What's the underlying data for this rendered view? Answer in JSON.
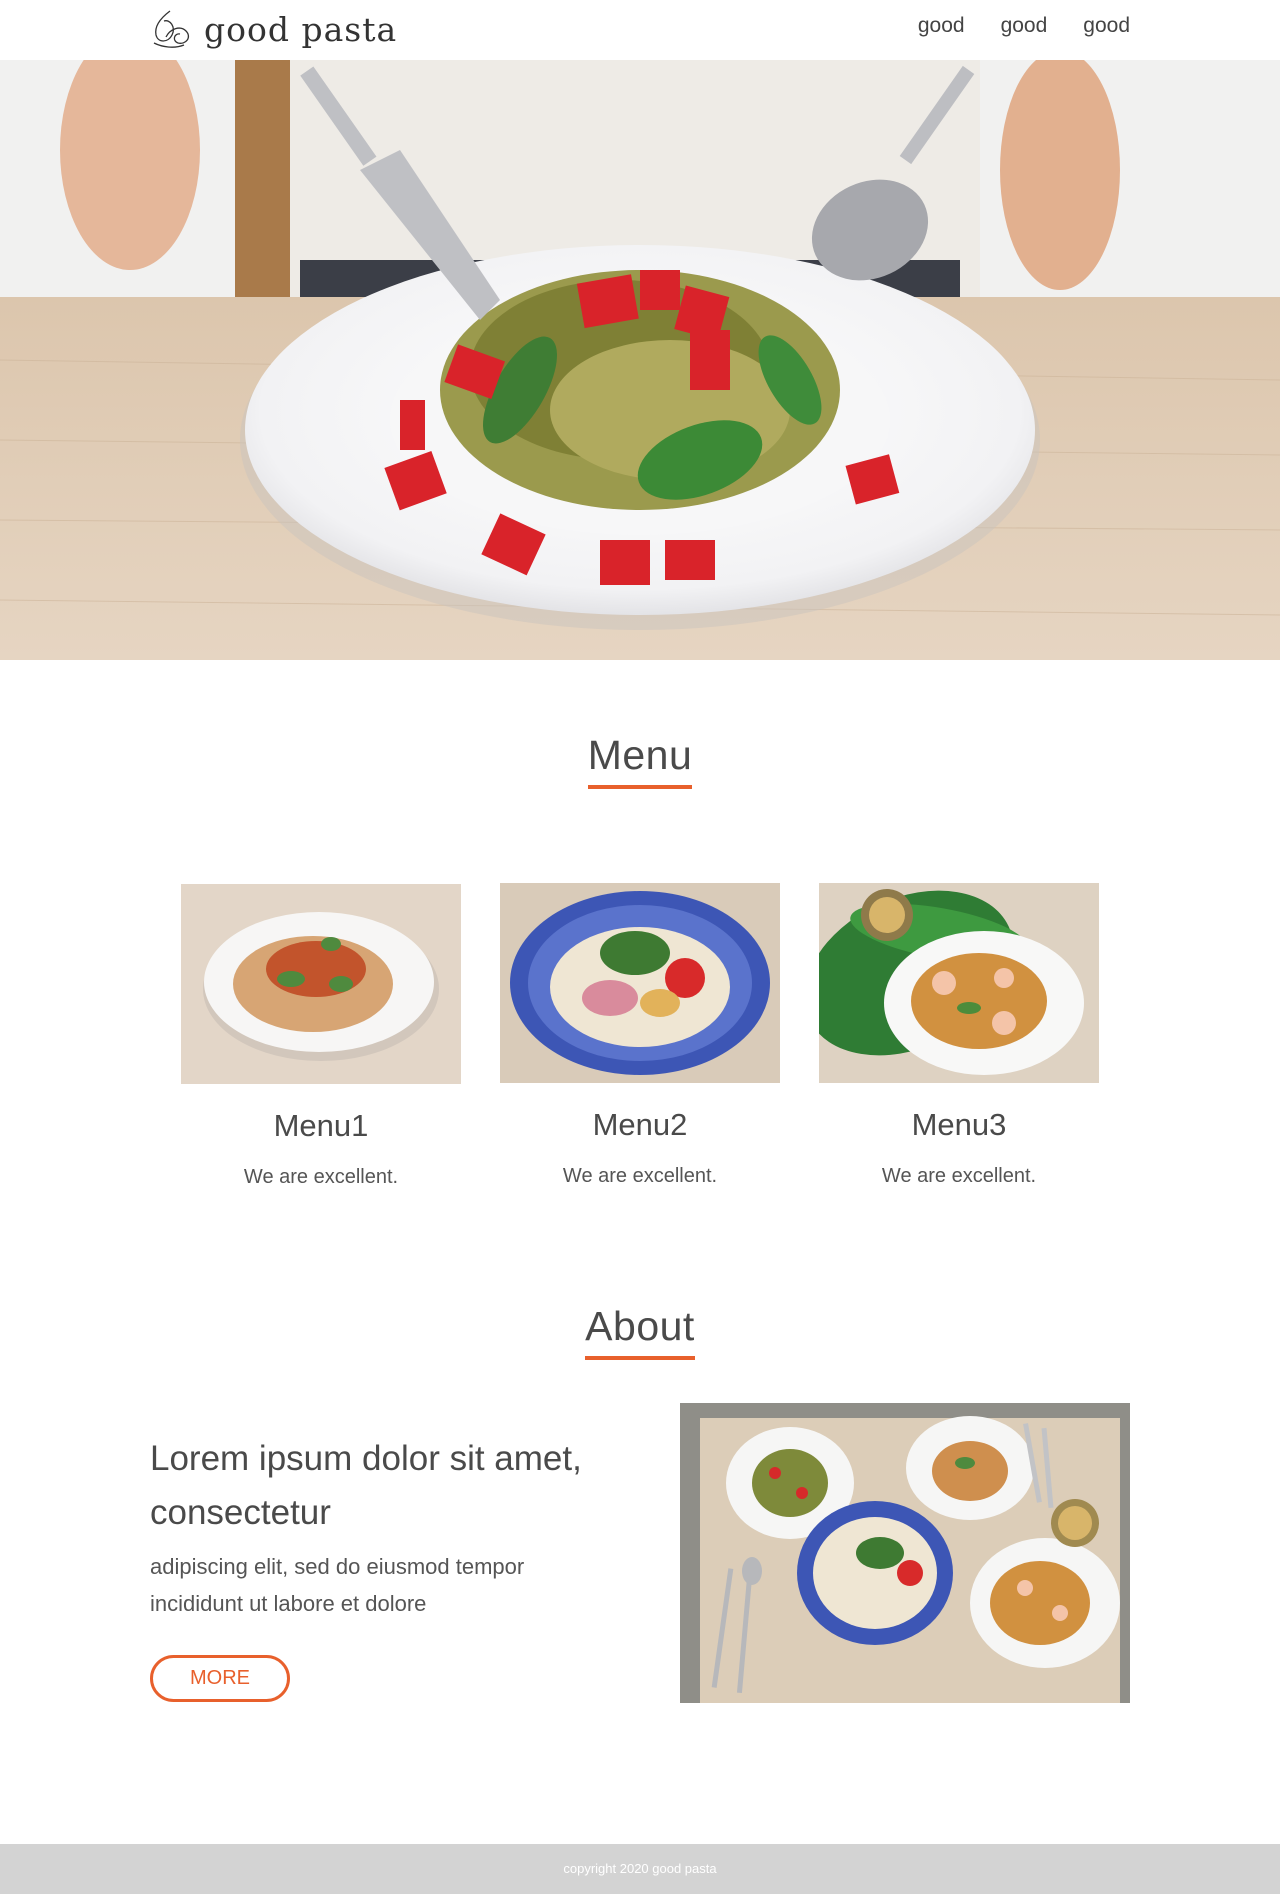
{
  "header": {
    "logo_text": "good pasta",
    "nav": [
      "good",
      "good",
      "good"
    ]
  },
  "menu": {
    "title": "Menu",
    "items": [
      {
        "name": "Menu1",
        "desc": "We are excellent."
      },
      {
        "name": "Menu2",
        "desc": "We are excellent."
      },
      {
        "name": "Menu3",
        "desc": "We are excellent."
      }
    ]
  },
  "about": {
    "title": "About",
    "heading": "Lorem ipsum dolor sit amet, consectetur",
    "body": "adipiscing elit, sed do eiusmod tempor incididunt ut labore et dolore",
    "button_label": "MORE"
  },
  "footer": {
    "copyright": "copyright  2020 good pasta"
  },
  "colors": {
    "accent": "#e8602c",
    "text": "#555555",
    "footer_bg": "#d3d3d3"
  },
  "icons": {
    "logo": "pasta-swirl-icon"
  }
}
